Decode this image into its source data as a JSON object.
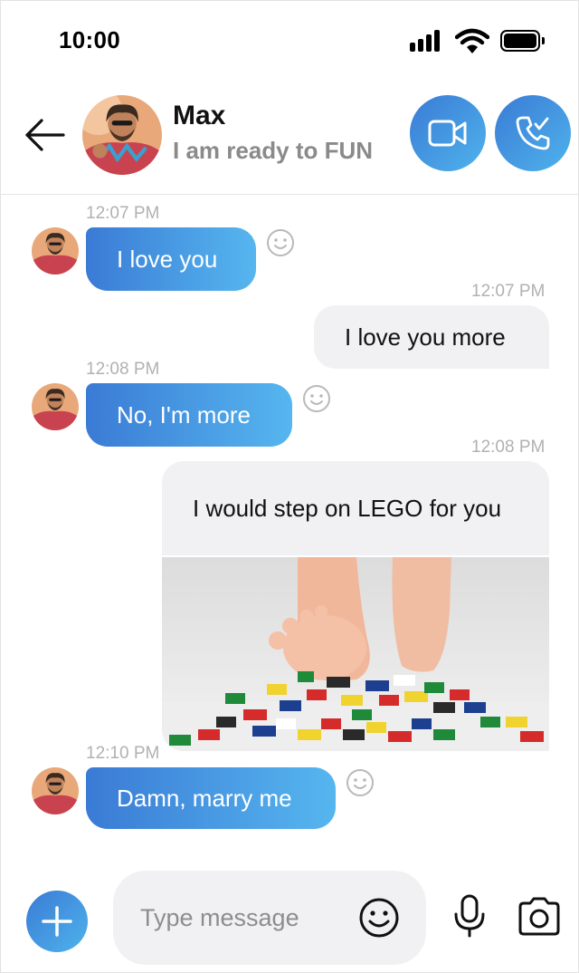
{
  "status_bar": {
    "time": "10:00",
    "icons": [
      "signal-icon",
      "wifi-icon",
      "battery-icon"
    ]
  },
  "header": {
    "contact_name": "Max",
    "contact_status": "I am ready to FUN",
    "actions": [
      "back-arrow-icon",
      "video-camera-icon",
      "phone-call-icon"
    ]
  },
  "messages": [
    {
      "direction": "incoming",
      "time": "12:07 PM",
      "text": "I love you"
    },
    {
      "direction": "outgoing",
      "time": "12:07 PM",
      "text": "I love you more"
    },
    {
      "direction": "incoming",
      "time": "12:08 PM",
      "text": "No, I'm more"
    },
    {
      "direction": "outgoing",
      "time": "12:08 PM",
      "text": "I would step on LEGO for you",
      "attachment": "photo"
    },
    {
      "direction": "incoming",
      "time": "12:10 PM",
      "text": "Damn, marry me"
    }
  ],
  "composer": {
    "placeholder": "Type message",
    "value": "",
    "icons": [
      "plus-icon",
      "smiley-icon",
      "microphone-icon",
      "camera-icon"
    ]
  },
  "colors": {
    "accent_start": "#3a7bd5",
    "accent_end": "#56b6ef",
    "outgoing_bubble": "#f1f1f3",
    "timestamp": "#b1b1b1",
    "status_text": "#8a8a8a"
  }
}
